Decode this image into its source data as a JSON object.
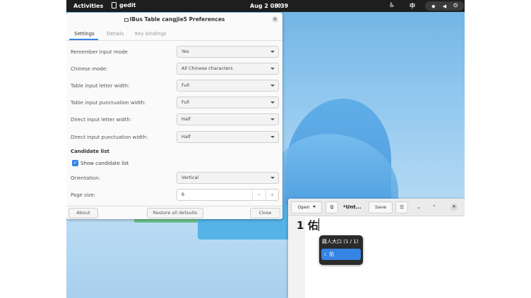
{
  "topbar": {
    "activities": "Activities",
    "app_name": "gedit",
    "clock": "Aug 2  08:39",
    "input_method": "中"
  },
  "prefs": {
    "title": "IBus Table cangjie5 Preferences",
    "tabs": [
      "Settings",
      "Details",
      "Key bindings"
    ],
    "active_tab": "Settings",
    "rows": [
      {
        "label": "Remember input mode",
        "value": "Yes"
      },
      {
        "label": "Chinese mode:",
        "value": "All Chinese characters"
      },
      {
        "label": "Table input letter width:",
        "value": "Full"
      },
      {
        "label": "Table input punctuation width:",
        "value": "Full"
      },
      {
        "label": "Direct input letter width:",
        "value": "Half"
      },
      {
        "label": "Direct input punctuation width:",
        "value": "Half"
      }
    ],
    "candidate_section": "Candidate list",
    "show_candidate_label": "Show candidate list",
    "show_candidate_checked": true,
    "orientation_label": "Orientation:",
    "orientation_value": "Vertical",
    "page_size_label": "Page size:",
    "page_size_value": "6",
    "footer": {
      "about": "About",
      "restore": "Restore all defaults",
      "close": "Close"
    }
  },
  "gedit": {
    "open_label": "Open",
    "doc_title": "*Unt...",
    "save_label": "Save",
    "text": "1 佑"
  },
  "candidates": {
    "header": "籍人大口 (1 / 1)",
    "items": [
      {
        "num": "1",
        "char": "佑"
      }
    ]
  },
  "colors": {
    "accent": "#3584e4",
    "topbar": "#1e1e1e"
  }
}
